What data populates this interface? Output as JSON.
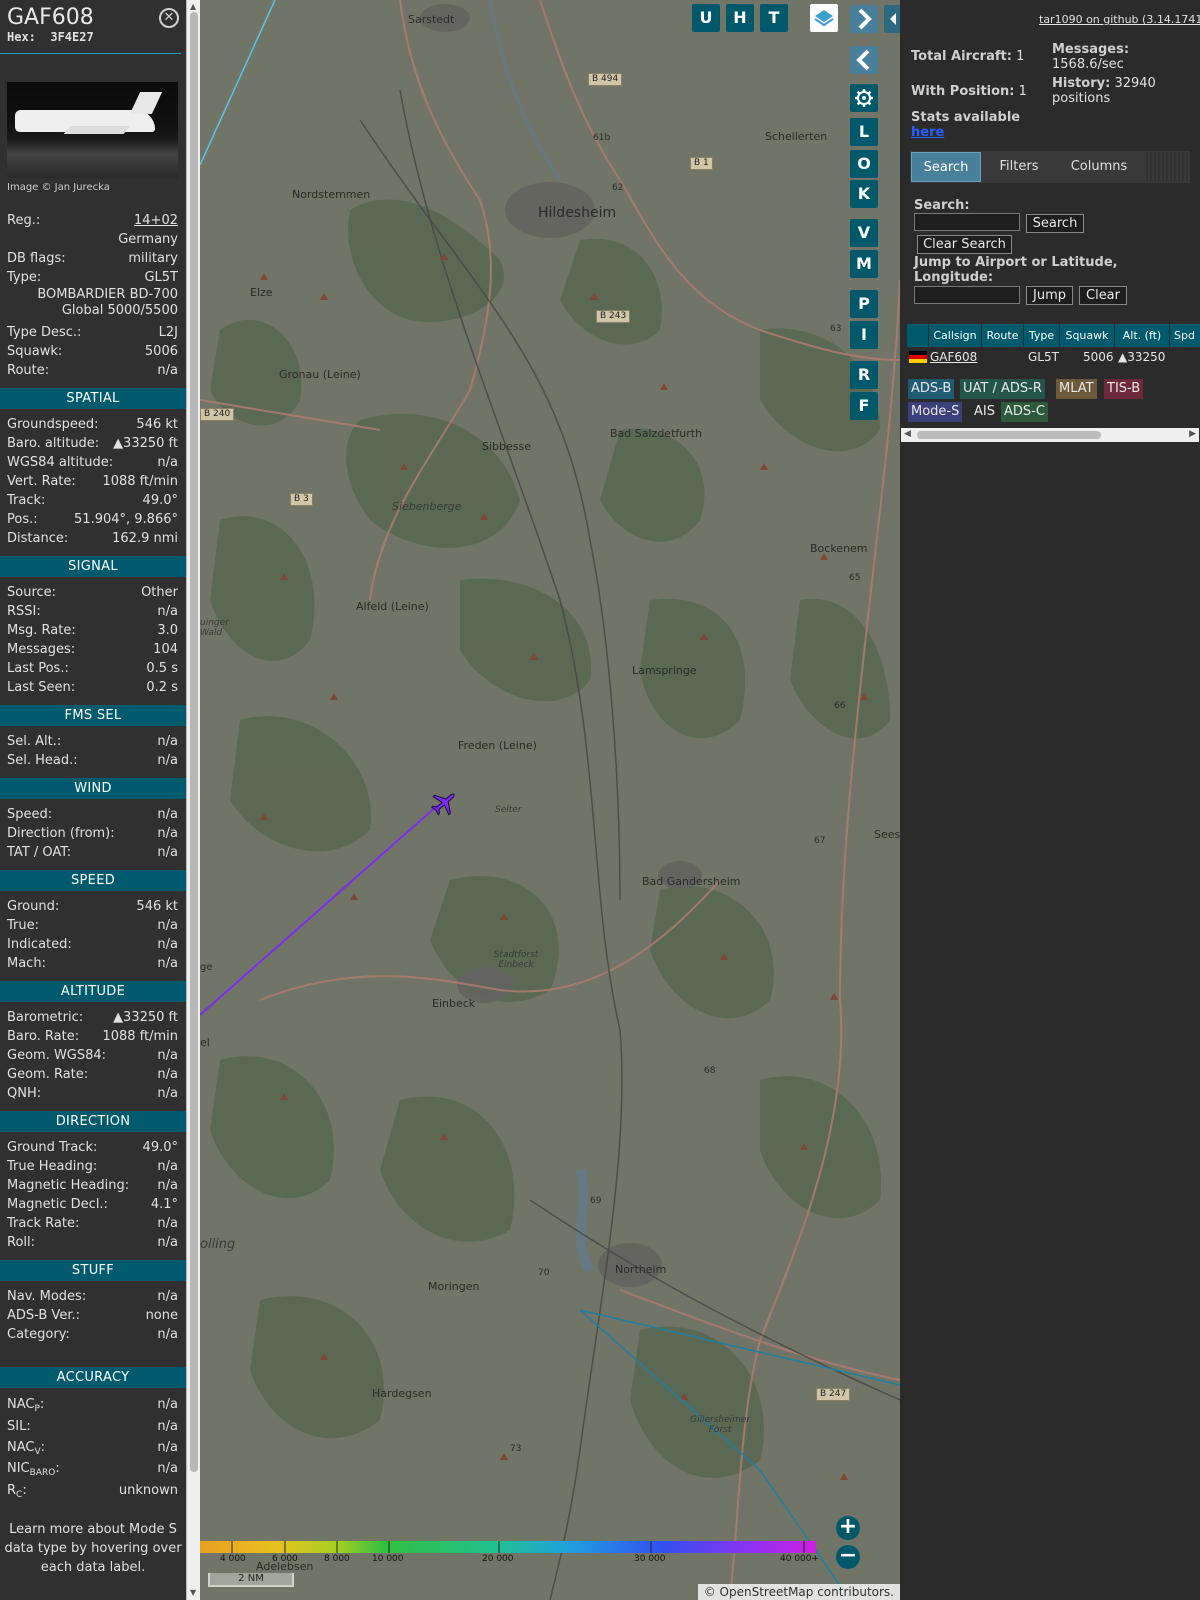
{
  "aircraft": {
    "callsign": "GAF608",
    "hex_label": "Hex:",
    "hex": "3F4E27",
    "photo_credit": "Image © Jan Jurecka",
    "reg_label": "Reg.:",
    "reg": "14+02",
    "country": "Germany",
    "dbflags_label": "DB flags:",
    "dbflags": "military",
    "type_label": "Type:",
    "type": "GL5T",
    "type_full_1": "BOMBARDIER BD-700",
    "type_full_2": "Global 5000/5500",
    "typedesc_label": "Type Desc.:",
    "typedesc": "L2J",
    "squawk_label": "Squawk:",
    "squawk": "5006",
    "route_label": "Route:",
    "route": "n/a"
  },
  "sections": {
    "spatial": "SPATIAL",
    "signal": "SIGNAL",
    "fmssel": "FMS SEL",
    "wind": "WIND",
    "speed": "SPEED",
    "altitude": "ALTITUDE",
    "direction": "DIRECTION",
    "stuff": "STUFF",
    "accuracy": "ACCURACY"
  },
  "spatial": [
    {
      "k": "Groundspeed:",
      "v": "546 kt"
    },
    {
      "k": "Baro. altitude:",
      "v": "▲33250 ft"
    },
    {
      "k": "WGS84 altitude:",
      "v": "n/a"
    },
    {
      "k": "Vert. Rate:",
      "v": "1088 ft/min"
    },
    {
      "k": "Track:",
      "v": "49.0°"
    },
    {
      "k": "Pos.:",
      "v": "51.904°, 9.866°"
    },
    {
      "k": "Distance:",
      "v": "162.9 nmi"
    }
  ],
  "signal": [
    {
      "k": "Source:",
      "v": "Other"
    },
    {
      "k": "RSSI:",
      "v": "n/a"
    },
    {
      "k": "Msg. Rate:",
      "v": "3.0"
    },
    {
      "k": "Messages:",
      "v": "104"
    },
    {
      "k": "Last Pos.:",
      "v": "0.5 s"
    },
    {
      "k": "Last Seen:",
      "v": "0.2 s"
    }
  ],
  "fmssel": [
    {
      "k": "Sel. Alt.:",
      "v": "n/a"
    },
    {
      "k": "Sel. Head.:",
      "v": "n/a"
    }
  ],
  "wind": [
    {
      "k": "Speed:",
      "v": "n/a"
    },
    {
      "k": "Direction (from):",
      "v": "n/a"
    },
    {
      "k": "TAT / OAT:",
      "v": "n/a"
    }
  ],
  "speed": [
    {
      "k": "Ground:",
      "v": "546 kt"
    },
    {
      "k": "True:",
      "v": "n/a"
    },
    {
      "k": "Indicated:",
      "v": "n/a"
    },
    {
      "k": "Mach:",
      "v": "n/a"
    }
  ],
  "altitude": [
    {
      "k": "Barometric:",
      "v": "▲33250 ft"
    },
    {
      "k": "Baro. Rate:",
      "v": "1088 ft/min"
    },
    {
      "k": "Geom. WGS84:",
      "v": "n/a"
    },
    {
      "k": "Geom. Rate:",
      "v": "n/a"
    },
    {
      "k": "QNH:",
      "v": "n/a"
    }
  ],
  "direction": [
    {
      "k": "Ground Track:",
      "v": "49.0°"
    },
    {
      "k": "True Heading:",
      "v": "n/a"
    },
    {
      "k": "Magnetic Heading:",
      "v": "n/a"
    },
    {
      "k": "Magnetic Decl.:",
      "v": "4.1°"
    },
    {
      "k": "Track Rate:",
      "v": "n/a"
    },
    {
      "k": "Roll:",
      "v": "n/a"
    }
  ],
  "stuff": [
    {
      "k": "Nav. Modes:",
      "v": "n/a"
    },
    {
      "k": "ADS-B Ver.:",
      "v": "none"
    },
    {
      "k": "Category:",
      "v": "n/a"
    }
  ],
  "accuracy": {
    "nacp_k": "NAC",
    "nacp_sub": "P",
    "nacp_v": "n/a",
    "sil_k": "SIL:",
    "sil_v": "n/a",
    "nacv_k": "NAC",
    "nacv_sub": "V",
    "nacv_v": "n/a",
    "nicbaro_k": "NIC",
    "nicbaro_sub": "BARO",
    "nicbaro_v": "n/a",
    "rc_k": "R",
    "rc_sub": "C",
    "rc_v": "unknown"
  },
  "learn_more": "Learn more about Mode S data type by hovering over each data label.",
  "map": {
    "buttons_top": [
      "U",
      "H",
      "T"
    ],
    "buttons_side": [
      "L",
      "O",
      "K",
      "V",
      "M",
      "P",
      "I",
      "R",
      "F"
    ],
    "places": [
      {
        "name": "Sarstedt"
      },
      {
        "name": "Nordstemmen"
      },
      {
        "name": "Hildesheim"
      },
      {
        "name": "Schellerten"
      },
      {
        "name": "Elze"
      },
      {
        "name": "Gronau (Leine)"
      },
      {
        "name": "Sibbesse"
      },
      {
        "name": "Bad Salzdetfurth"
      },
      {
        "name": "Siebenberge"
      },
      {
        "name": "Bockenem"
      },
      {
        "name": "Alfeld (Leine)"
      },
      {
        "name": "Lamspringe"
      },
      {
        "name": "Freden (Leine)"
      },
      {
        "name": "Selter"
      },
      {
        "name": "Bad Gandersheim"
      },
      {
        "name": "Stadtforst Einbeck"
      },
      {
        "name": "Einbeck"
      },
      {
        "name": "Northeim"
      },
      {
        "name": "Moringen"
      },
      {
        "name": "Hardegsen"
      },
      {
        "name": "Gillersheimer Forst"
      },
      {
        "name": "Adelebsen"
      },
      {
        "name": "Seese"
      },
      {
        "name": "olling"
      },
      {
        "name": "ge"
      },
      {
        "name": "el"
      },
      {
        "name": "uinger Wald"
      }
    ],
    "roads": [
      "B 494",
      "B 1",
      "B 243",
      "B 240",
      "B 3",
      "B 247"
    ],
    "road_numbers": [
      "61b",
      "62",
      "63",
      "65",
      "66",
      "67",
      "68",
      "69",
      "70",
      "73"
    ],
    "altitude_scale": [
      "4 000",
      "6 000",
      "8 000",
      "10 000",
      "20 000",
      "30 000",
      "40 000+"
    ],
    "scale_label": "2 NM",
    "attribution": "© OpenStreetMap contributors.",
    "zoom_in": "+",
    "zoom_out": "−",
    "colors": {
      "track": "#7b2cf0",
      "aircraft": "#7b2cf0",
      "range_ring": "#1f7fa3"
    }
  },
  "right": {
    "version": "tar1090 on github (3.14.1741)",
    "total_label": "Total Aircraft:",
    "total": "1",
    "messages_label": "Messages:",
    "messages": "1568.6/sec",
    "withpos_label": "With Position:",
    "withpos": "1",
    "history_label": "History:",
    "history": "32940 positions",
    "stats_label": "Stats available",
    "stats_link": "here",
    "tabs": [
      "Search",
      "Filters",
      "Columns"
    ],
    "search_label": "Search:",
    "search_button": "Search",
    "clear_search_button": "Clear Search",
    "jump_label": "Jump to Airport or Latitude, Longitude:",
    "jump_button": "Jump",
    "clear_button": "Clear",
    "columns": [
      "Callsign",
      "Route",
      "Type",
      "Squawk",
      "Alt. (ft)",
      "Spd"
    ],
    "table_row": {
      "callsign": "GAF608",
      "route": "",
      "type": "GL5T",
      "squawk": "5006",
      "alt": "▲33250"
    },
    "sources": [
      "ADS-B",
      "UAT / ADS-R",
      "MLAT",
      "TIS-B",
      "Mode-S",
      "AIS",
      "ADS-C"
    ],
    "source_colors": {
      "ADS-B": "#1f5b73",
      "UAT / ADS-R": "#24554b",
      "MLAT": "#6e5a3a",
      "TIS-B": "#6e2a3d",
      "Mode-S": "#3b3f7a",
      "AIS": "#2b2b2b",
      "ADS-C": "#2c5a3a"
    }
  }
}
